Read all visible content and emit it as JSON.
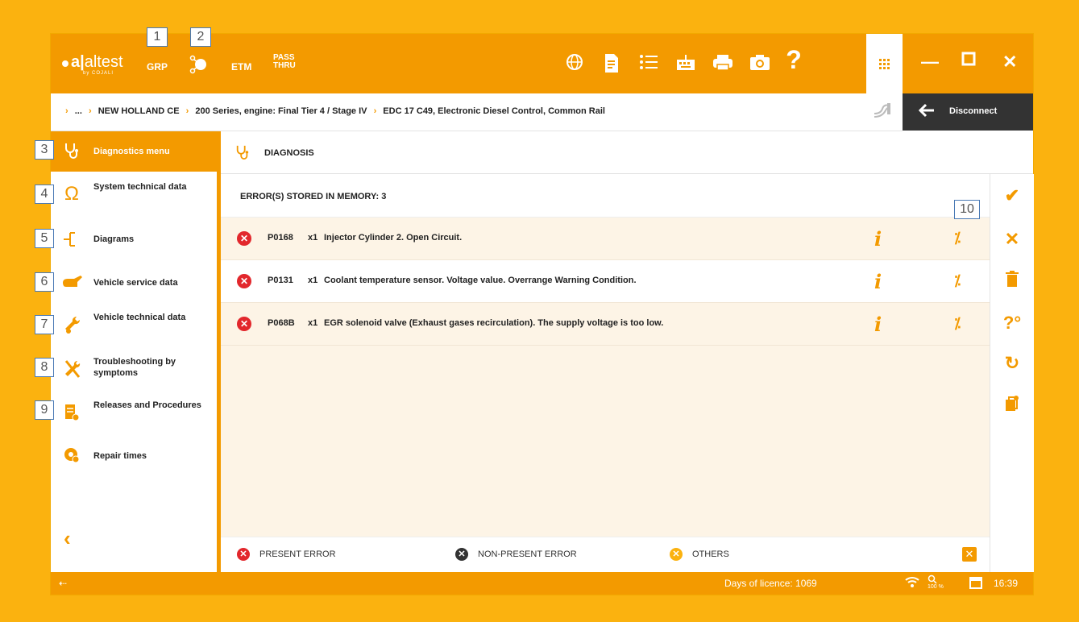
{
  "app": {
    "logo_text": "altest",
    "logo_sub": "by COJALI"
  },
  "toolbar": {
    "grp": "GRP",
    "etm": "ETM",
    "pass_thru_line1": "PASS",
    "pass_thru_line2": "THRU",
    "icons": [
      "globe-icon",
      "document-icon",
      "list-icon",
      "keyboard-icon",
      "printer-icon",
      "camera-icon",
      "help-icon",
      "apps-grid-icon"
    ]
  },
  "window": {
    "minimize": "—",
    "maximize": "□",
    "close": "✕"
  },
  "breadcrumb": {
    "items": [
      "...",
      "NEW HOLLAND CE",
      "200 Series, engine: Final Tier 4 / Stage IV",
      "EDC 17 C49, Electronic Diesel Control, Common Rail"
    ]
  },
  "disconnect": {
    "label": "Disconnect"
  },
  "sidebar": {
    "items": [
      {
        "label": "Diagnostics menu",
        "icon": "stethoscope-icon",
        "active": true
      },
      {
        "label": "System technical data",
        "icon": "omega-icon"
      },
      {
        "label": "Diagrams",
        "icon": "diagram-icon"
      },
      {
        "label": "Vehicle service data",
        "icon": "oil-can-icon"
      },
      {
        "label": "Vehicle technical data",
        "icon": "wrench-icon"
      },
      {
        "label": "Troubleshooting by symptoms",
        "icon": "tools-icon"
      },
      {
        "label": "Releases and Procedures",
        "icon": "procedures-icon"
      },
      {
        "label": "Repair times",
        "icon": "gear-clock-icon"
      }
    ],
    "back": "‹"
  },
  "main": {
    "title": "DIAGNOSIS",
    "errors_header": "ERROR(S) STORED IN MEMORY: 3",
    "errors": [
      {
        "code": "P0168",
        "count": "x1",
        "description": "Injector Cylinder 2. Open Circuit."
      },
      {
        "code": "P0131",
        "count": "x1",
        "description": "Coolant temperature sensor. Voltage value. Overrange Warning Condition."
      },
      {
        "code": "P068B",
        "count": "x1",
        "description": "EGR solenoid valve (Exhaust gases recirculation). The supply voltage is too low."
      }
    ]
  },
  "legend": {
    "present": "PRESENT ERROR",
    "non_present": "NON-PRESENT ERROR",
    "others": "OTHERS"
  },
  "right_actions": [
    "check-icon",
    "close-icon",
    "trash-icon",
    "help-settings-icon",
    "refresh-icon",
    "procedure-icon"
  ],
  "status": {
    "licence": "Days of licence: 1069",
    "time": "16:39",
    "usb": "⇠",
    "zoom": "100 %"
  },
  "callouts": [
    "1",
    "2",
    "3",
    "4",
    "5",
    "6",
    "7",
    "8",
    "9",
    "10"
  ],
  "colors": {
    "accent": "#f39a00",
    "error_red": "#e2272c",
    "non_present": "#333333",
    "others": "#fbb20f",
    "background": "#fbb20f"
  }
}
